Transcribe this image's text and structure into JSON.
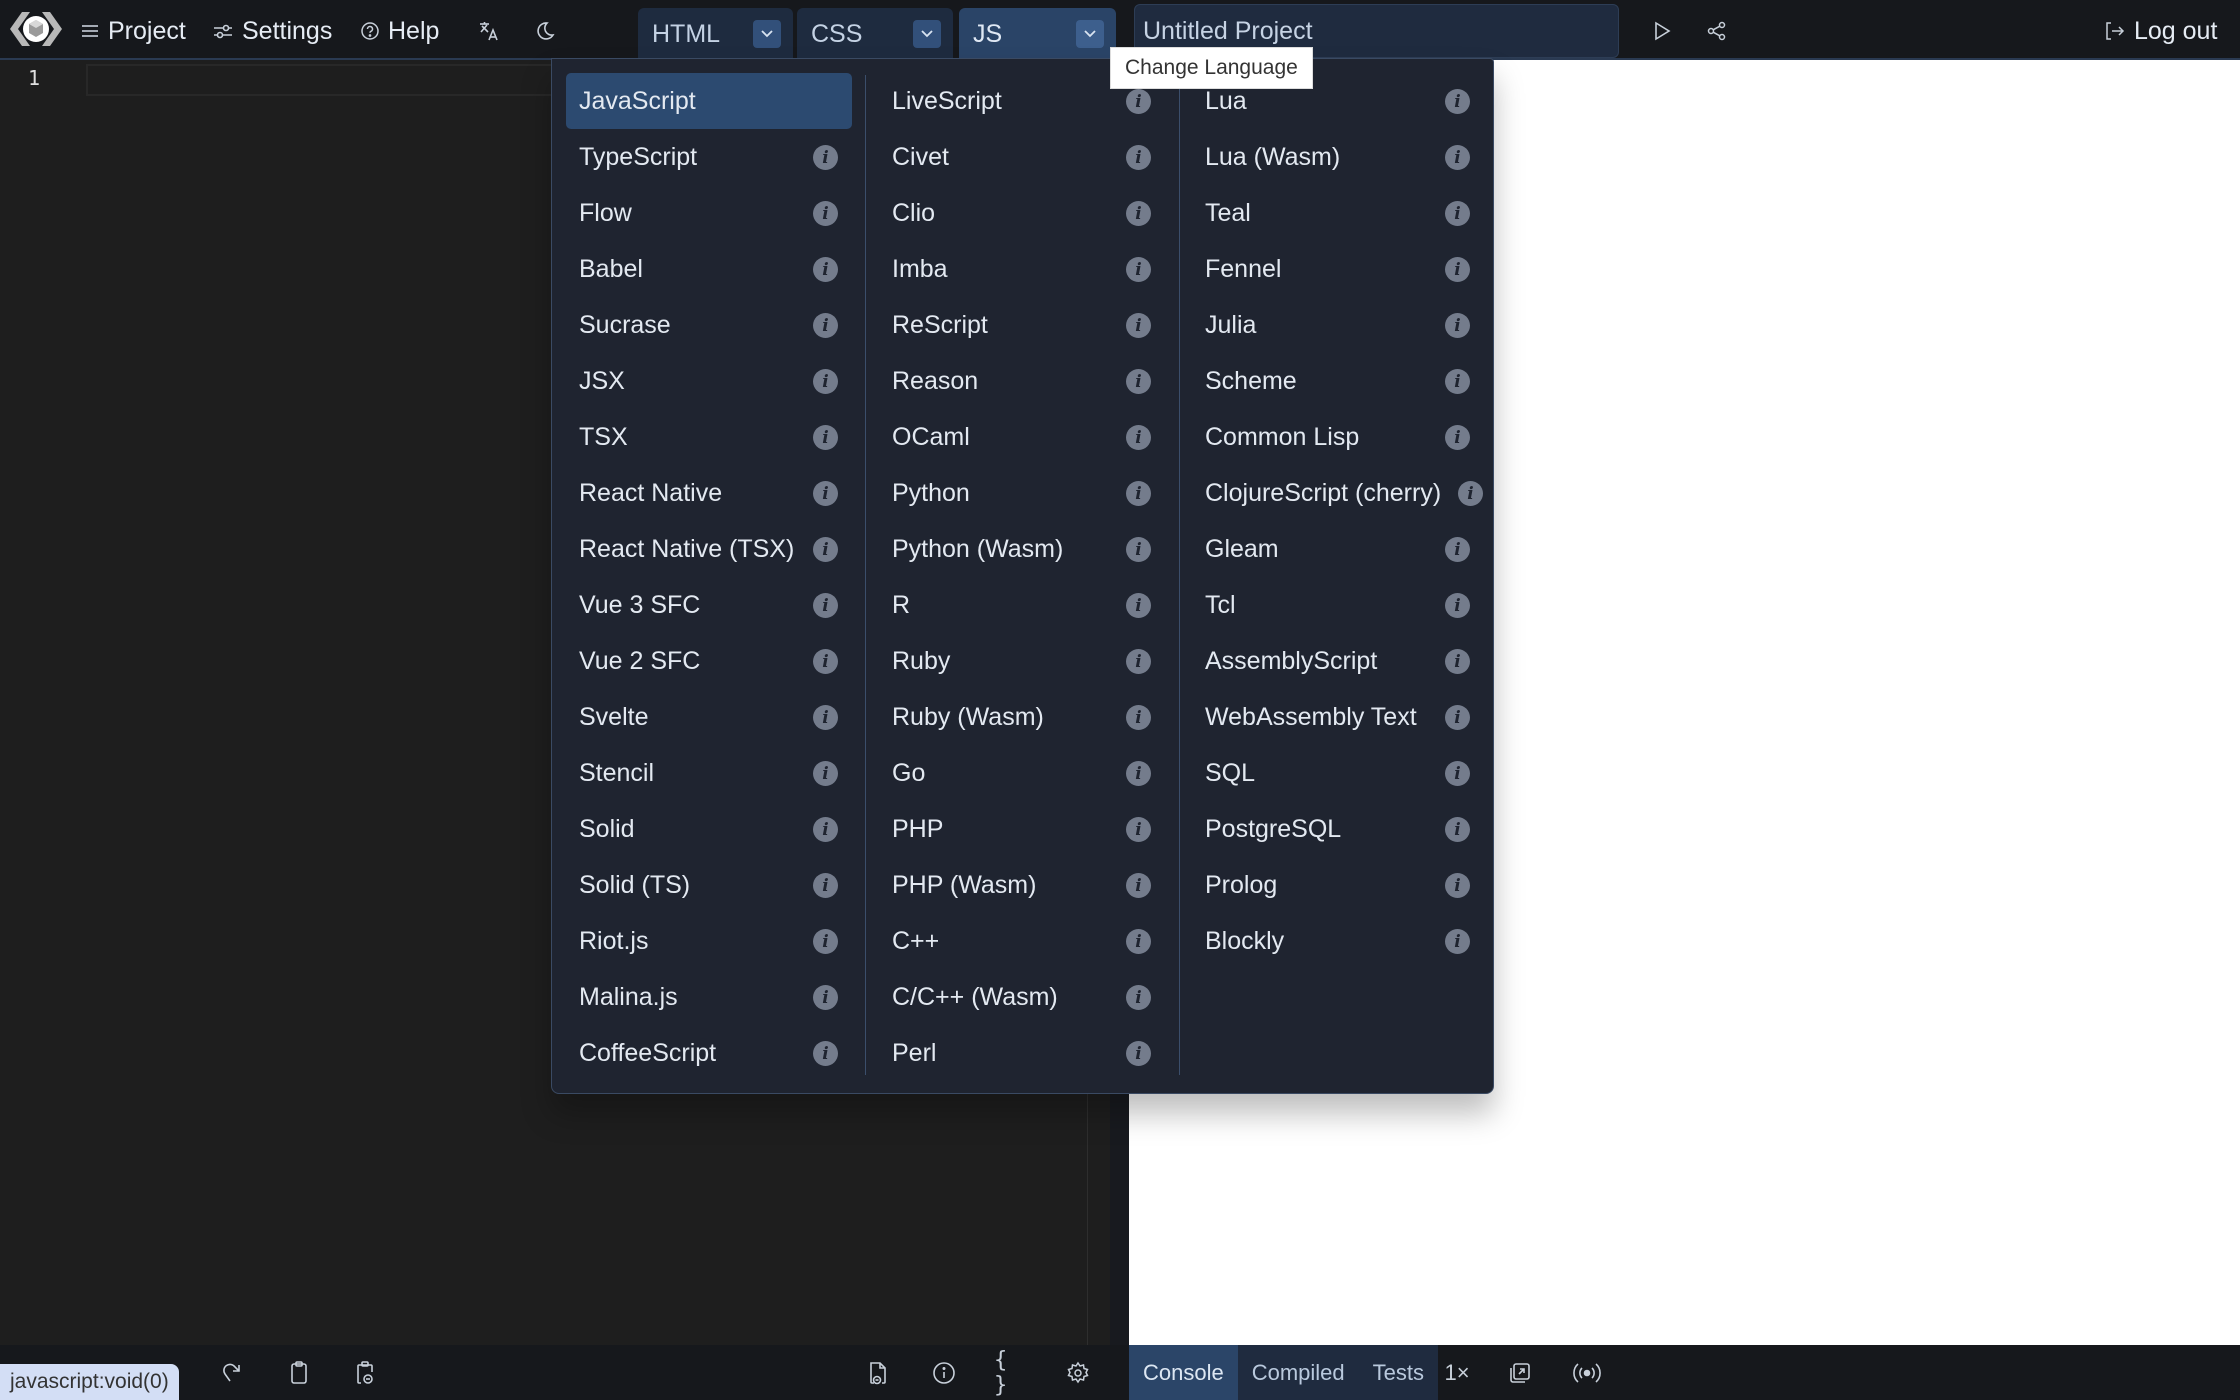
{
  "header": {
    "logo": "livecodes-logo",
    "menu": [
      {
        "label": "Project",
        "icon": "hamburger-icon"
      },
      {
        "label": "Settings",
        "icon": "sliders-icon"
      },
      {
        "label": "Help",
        "icon": "question-circle-icon"
      }
    ],
    "i18n_icon": "translate-icon",
    "theme_icon": "moon-icon",
    "editor_tabs": [
      {
        "label": "HTML",
        "active": false
      },
      {
        "label": "CSS",
        "active": false
      },
      {
        "label": "JS",
        "active": true
      }
    ],
    "project_title": "Untitled Project",
    "run_icon": "play-icon",
    "share_icon": "share-icon",
    "logout_label": "Log out"
  },
  "editor": {
    "line_numbers": [
      "1"
    ],
    "content": ""
  },
  "tooltip": "Change Language",
  "language_menu": {
    "selected": "JavaScript",
    "columns": [
      [
        "JavaScript",
        "TypeScript",
        "Flow",
        "Babel",
        "Sucrase",
        "JSX",
        "TSX",
        "React Native",
        "React Native (TSX)",
        "Vue 3 SFC",
        "Vue 2 SFC",
        "Svelte",
        "Stencil",
        "Solid",
        "Solid (TS)",
        "Riot.js",
        "Malina.js",
        "CoffeeScript"
      ],
      [
        "LiveScript",
        "Civet",
        "Clio",
        "Imba",
        "ReScript",
        "Reason",
        "OCaml",
        "Python",
        "Python (Wasm)",
        "R",
        "Ruby",
        "Ruby (Wasm)",
        "Go",
        "PHP",
        "PHP (Wasm)",
        "C++",
        "C/C++ (Wasm)",
        "Perl"
      ],
      [
        "Lua",
        "Lua (Wasm)",
        "Teal",
        "Fennel",
        "Julia",
        "Scheme",
        "Common Lisp",
        "ClojureScript (cherry)",
        "Gleam",
        "Tcl",
        "AssemblyScript",
        "WebAssembly Text",
        "SQL",
        "PostgreSQL",
        "Prolog",
        "Blockly"
      ]
    ],
    "info_glyph": "i"
  },
  "bottom_toolbar": {
    "status_link": "javascript:void(0)",
    "left_tools": [
      "redo-icon",
      "copy-icon",
      "copy-as-url-icon"
    ],
    "right_tools": [
      "external-resources-icon",
      "info-icon",
      "format-icon",
      "editor-settings-icon"
    ],
    "format_glyph": "{ }",
    "tool_tabs": [
      {
        "label": "Console",
        "active": true
      },
      {
        "label": "Compiled",
        "active": false
      },
      {
        "label": "Tests",
        "active": false
      }
    ],
    "zoom_label": "1×",
    "result_tools": [
      "open-in-new-window-icon",
      "broadcast-icon"
    ]
  },
  "colors": {
    "header_bg": "#16181c",
    "editor_bg": "#1e1e1e",
    "dropdown_bg": "#1f2430",
    "selected_bg": "#2c4a70",
    "tab_active_bg": "#2a4467",
    "tab_bg": "#1e2b3f",
    "result_bg": "#ffffff"
  }
}
